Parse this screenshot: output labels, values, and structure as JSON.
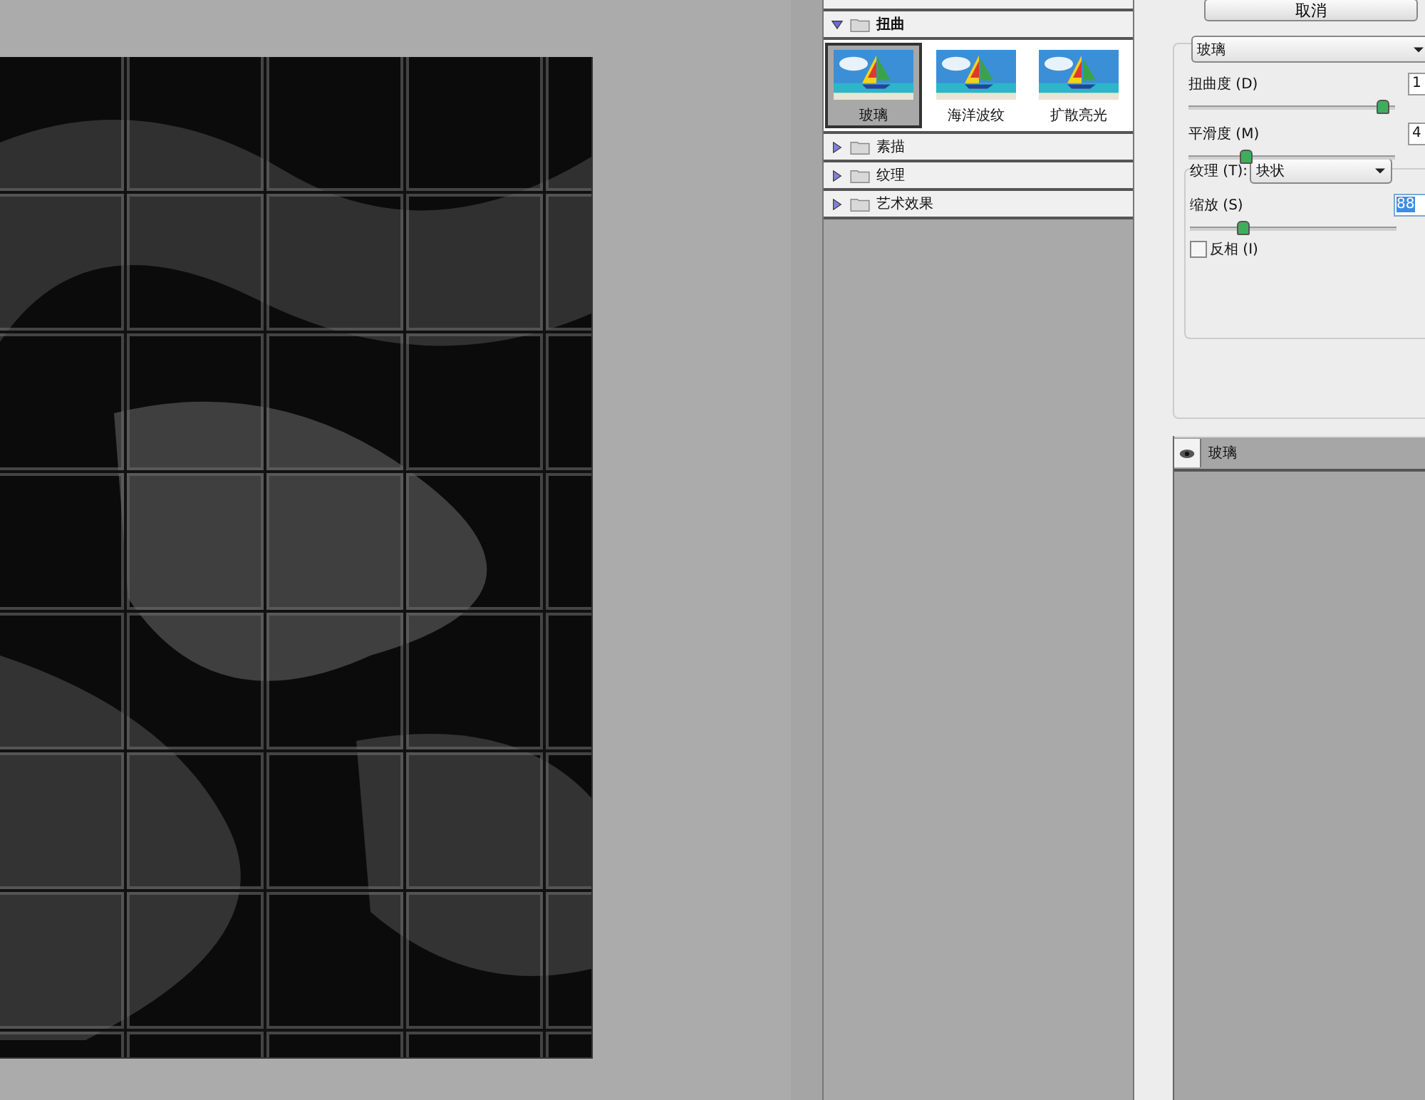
{
  "cancel_button": "取消",
  "filter_categories": [
    {
      "name": "扭曲",
      "expanded": true,
      "filters": [
        {
          "name": "玻璃",
          "selected": true
        },
        {
          "name": "海洋波纹",
          "selected": false
        },
        {
          "name": "扩散亮光",
          "selected": false
        }
      ]
    },
    {
      "name": "素描",
      "expanded": false
    },
    {
      "name": "纹理",
      "expanded": false
    },
    {
      "name": "艺术效果",
      "expanded": false
    }
  ],
  "settings": {
    "filter_select": "玻璃",
    "sliders": [
      {
        "label": "扭曲度 (D)",
        "value": "1",
        "level": 0.93
      },
      {
        "label": "平滑度 (M)",
        "value": "4",
        "level": 0.27
      }
    ],
    "texture": {
      "label": "纹理 (T):",
      "value": "块状"
    },
    "scaling": {
      "label": "缩放 (S)",
      "value": "88",
      "level": 0.25,
      "selected": true
    },
    "invert": {
      "label": "反相 (I)",
      "checked": false
    }
  },
  "effect_layers": [
    {
      "name": "玻璃",
      "visible": true
    }
  ]
}
